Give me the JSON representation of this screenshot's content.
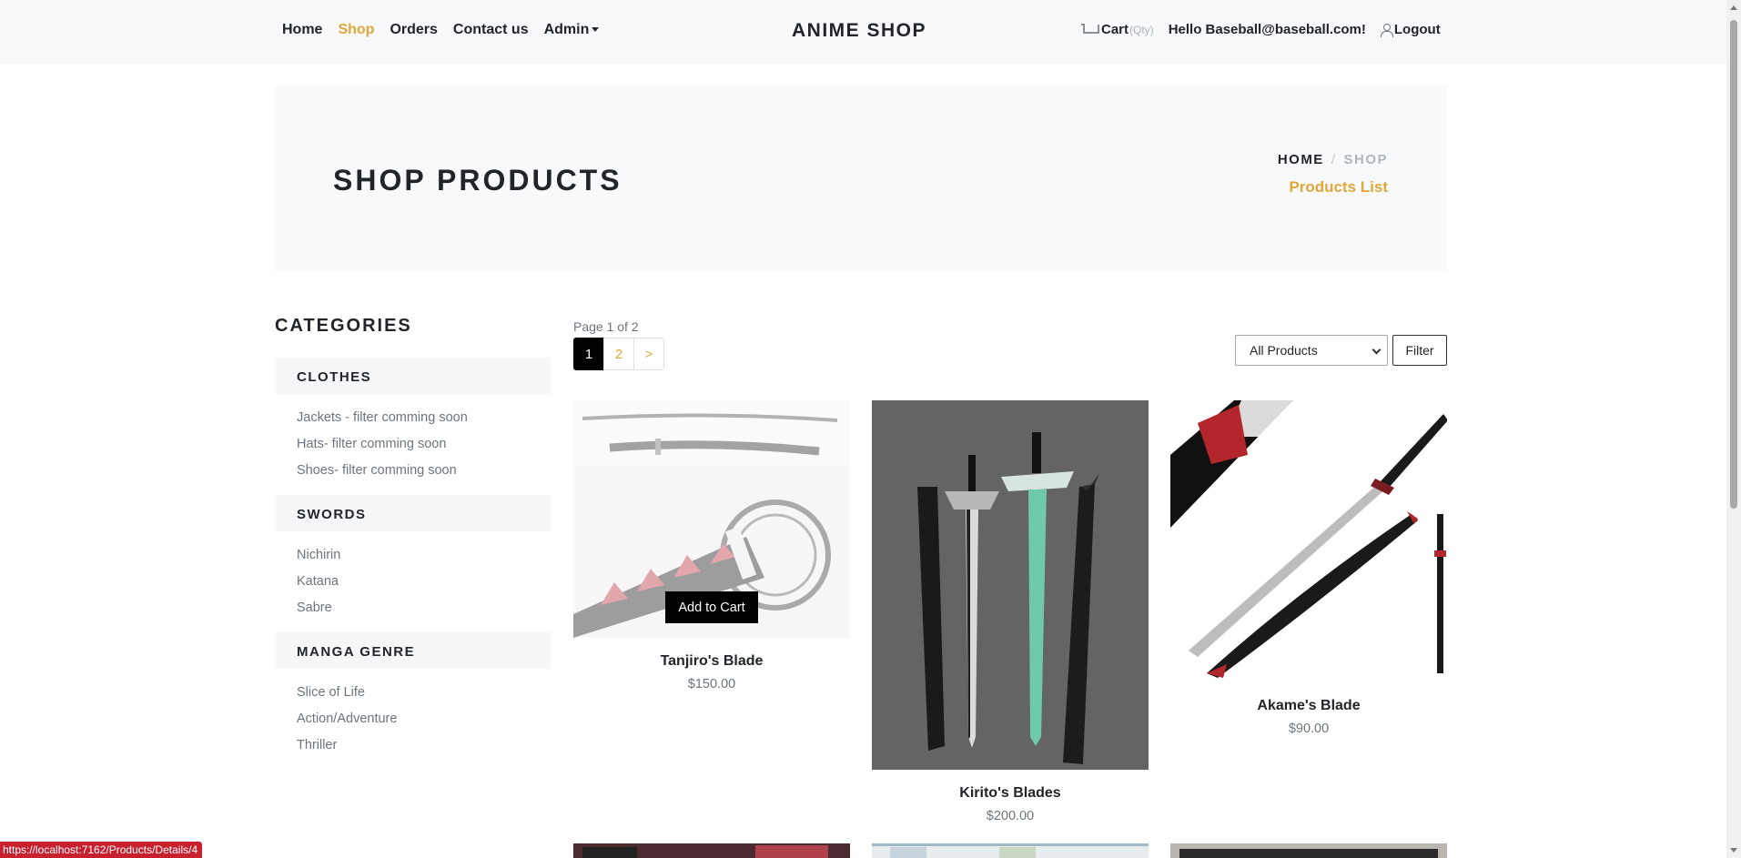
{
  "nav": {
    "links": [
      {
        "label": "Home"
      },
      {
        "label": "Shop"
      },
      {
        "label": "Orders"
      },
      {
        "label": "Contact us"
      },
      {
        "label": "Admin"
      }
    ],
    "brand": "ANIME SHOP",
    "cart_label": "Cart",
    "cart_qty": "(Qty)",
    "greeting": "Hello Baseball@baseball.com!",
    "logout_label": "Logout"
  },
  "hero": {
    "title": "SHOP PRODUCTS",
    "breadcrumb_home": "HOME",
    "breadcrumb_sep": "/",
    "breadcrumb_shop": "SHOP",
    "breadcrumb_sub": "Products List"
  },
  "sidebar": {
    "title": "CATEGORIES",
    "groups": [
      {
        "title": "CLOTHES",
        "items": [
          "Jackets - filter comming soon",
          "Hats- filter comming soon",
          "Shoes- filter comming soon"
        ]
      },
      {
        "title": "SWORDS",
        "items": [
          "Nichirin",
          "Katana",
          "Sabre"
        ]
      },
      {
        "title": "MANGA GENRE",
        "items": [
          "Slice of Life",
          "Action/Adventure",
          "Thriller"
        ]
      }
    ]
  },
  "listing": {
    "page_info": "Page 1 of 2",
    "pages": [
      "1",
      "2",
      ">"
    ],
    "filter_value": "All Products",
    "filter_button": "Filter"
  },
  "products": [
    {
      "name": "Tanjiro's Blade",
      "price": "$150.00",
      "add_label": "Add to Cart"
    },
    {
      "name": "Kirito's Blades",
      "price": "$200.00"
    },
    {
      "name": "Akame's Blade",
      "price": "$90.00"
    }
  ],
  "status_url": "https://localhost:7162/Products/Details/4",
  "colors": {
    "accent": "#e0a83a",
    "hero_bg": "#f8f9fa",
    "status_bar": "#c8202e"
  }
}
